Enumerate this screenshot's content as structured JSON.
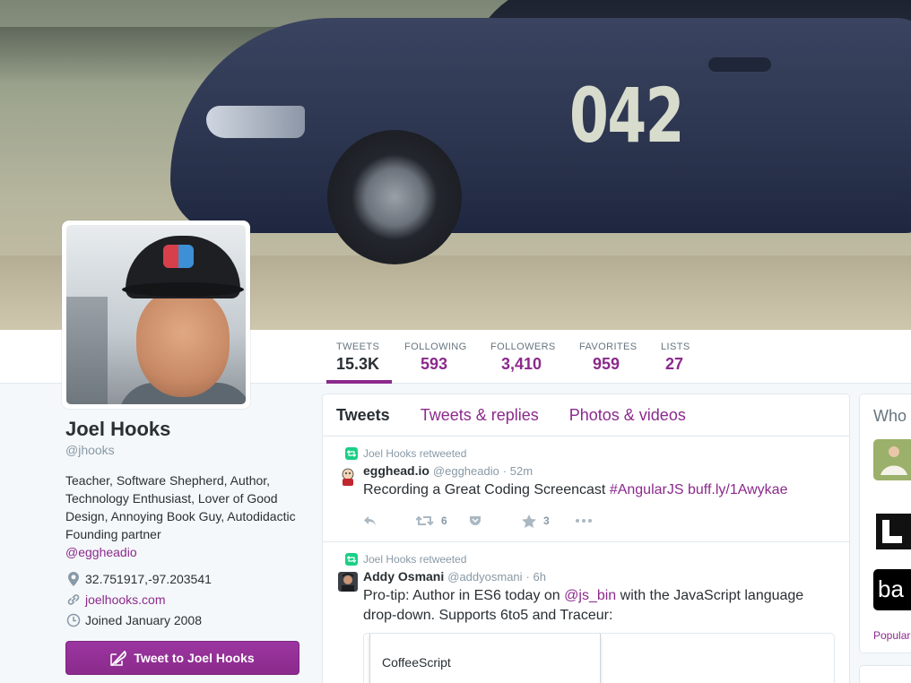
{
  "banner": {
    "car_number": "042"
  },
  "nav": {
    "stats": [
      {
        "label": "TWEETS",
        "value": "15.3K"
      },
      {
        "label": "FOLLOWING",
        "value": "593"
      },
      {
        "label": "FOLLOWERS",
        "value": "3,410"
      },
      {
        "label": "FAVORITES",
        "value": "959"
      },
      {
        "label": "LISTS",
        "value": "27"
      }
    ]
  },
  "profile": {
    "name": "Joel Hooks",
    "handle": "@jhooks",
    "bio": "Teacher, Software Shepherd, Author, Technology Enthusiast, Lover of Good Design, Annoying Book Guy, Autodidactic Founding partner",
    "bio_link": "@eggheadio",
    "location": "32.751917,-97.203541",
    "website": "joelhooks.com",
    "joined": "Joined January 2008",
    "tweet_to_label": "Tweet to Joel Hooks"
  },
  "timeline": {
    "tabs": [
      "Tweets",
      "Tweets & replies",
      "Photos & videos"
    ],
    "tweets": [
      {
        "retweeted_by": "Joel Hooks retweeted",
        "user": "egghead.io",
        "screen_name": "@eggheadio",
        "time": "· 52m",
        "text_prefix": "Recording a Great Coding Screencast ",
        "hashtag": "#AngularJS",
        "link": "buff.ly/1Awykae",
        "retweets": "6",
        "favorites": "3"
      },
      {
        "retweeted_by": "Joel Hooks retweeted",
        "user": "Addy Osmani",
        "screen_name": "@addyosmani",
        "time": "· 6h",
        "text_prefix": "Pro-tip: Author in ES6 today on ",
        "mention": "@js_bin",
        "text_suffix": " with the JavaScript language drop-down. Supports 6to5 and Traceur:",
        "card_option": "CoffeeScript"
      }
    ]
  },
  "sidebar_right": {
    "title": "Who to follow",
    "popular_label": "Popular"
  },
  "colors": {
    "accent": "#8b2a8c",
    "retweet_green": "#19cf86",
    "text": "#292f33",
    "muted": "#8899a6"
  }
}
